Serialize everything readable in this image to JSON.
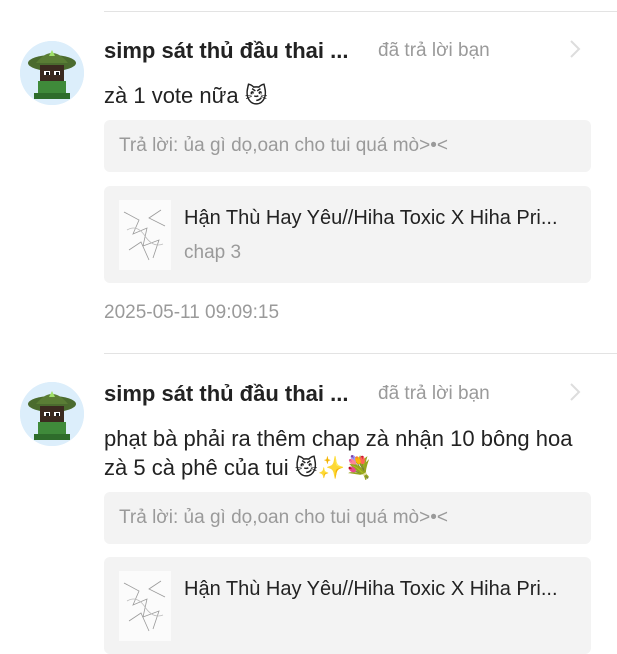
{
  "comments": [
    {
      "username": "simp sát thủ đầu thai ...",
      "action": "đã trả lời bạn",
      "message": "zà 1 vote nữa 😼",
      "reply_quote": "Trả lời: ủa gì dọ,oan cho tui quá mò>•<",
      "story_title": "Hận Thù Hay Yêu//Hiha Toxic X Hiha Pri...",
      "chapter": "chap 3",
      "timestamp": "2025-05-11 09:09:15"
    },
    {
      "username": "simp sát thủ đầu thai ...",
      "action": "đã trả lời bạn",
      "message": "phạt bà phải ra thêm chap zà nhận 10 bông hoa zà 5 cà phê của tui 😼✨💐",
      "reply_quote": "Trả lời: ủa gì dọ,oan cho tui quá mò>•<",
      "story_title": "Hận Thù Hay Yêu//Hiha Toxic X Hiha Pri..."
    }
  ],
  "icons": {
    "chevron": "chevron-right-icon",
    "avatar": "avatar-icon"
  },
  "colors": {
    "muted_text": "#9a9a9a",
    "card_bg": "#f3f3f3",
    "divider": "#e3e3e3"
  }
}
